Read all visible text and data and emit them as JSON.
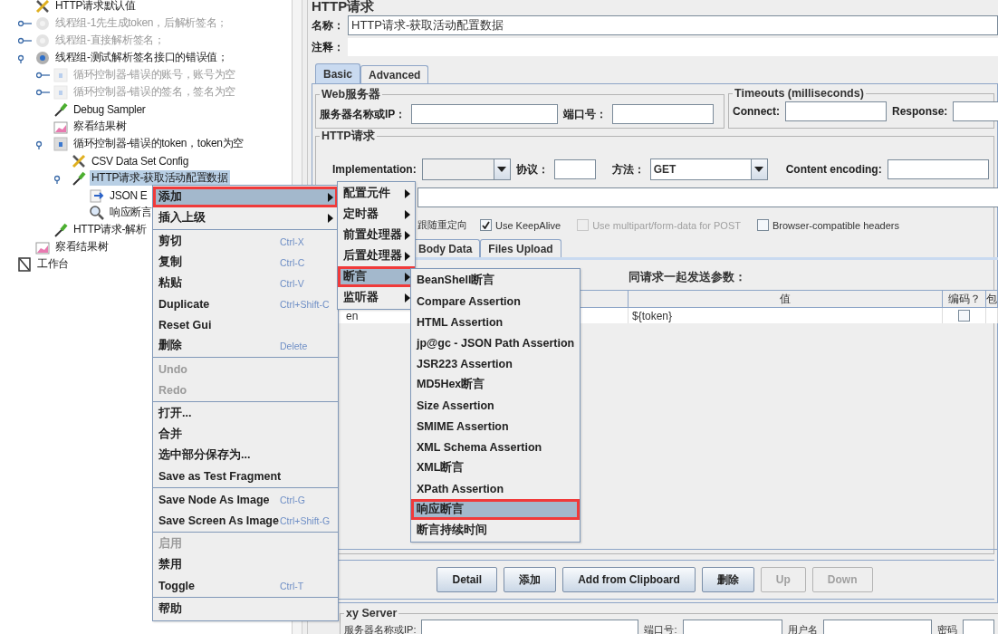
{
  "tree": {
    "plan_children": [
      {
        "label": "HTTP请求默认值",
        "kind": "config",
        "disabled": false,
        "selected": false
      },
      {
        "label": "线程组-1先生成token，后解析签名；",
        "kind": "thread-group",
        "disabled": true,
        "selected": false,
        "expanded": false
      },
      {
        "label": "线程组-直接解析签名；",
        "kind": "thread-group",
        "disabled": true,
        "selected": false,
        "expanded": false
      },
      {
        "label": "线程组-测试解析签名接口的错误值；",
        "kind": "thread-group",
        "disabled": false,
        "selected": false,
        "expanded": true,
        "children": [
          {
            "label": "循环控制器-错误的账号，账号为空",
            "kind": "controller",
            "disabled": true,
            "selected": false,
            "expanded": false
          },
          {
            "label": "循环控制器-错误的签名，签名为空",
            "kind": "controller",
            "disabled": true,
            "selected": false,
            "expanded": false
          },
          {
            "label": "Debug Sampler",
            "kind": "sampler",
            "disabled": false,
            "selected": false
          },
          {
            "label": "察看结果树",
            "kind": "listener",
            "disabled": false,
            "selected": false
          },
          {
            "label": "循环控制器-错误的token，token为空",
            "kind": "controller",
            "disabled": false,
            "selected": false,
            "expanded": true,
            "children": [
              {
                "label": "CSV Data Set Config",
                "kind": "config",
                "disabled": false,
                "selected": false
              },
              {
                "label": "HTTP请求-获取活动配置数据",
                "kind": "sampler",
                "disabled": false,
                "selected": true,
                "expanded": true,
                "children": [
                  {
                    "label": "JSON E",
                    "kind": "extractor",
                    "disabled": false,
                    "selected": false
                  },
                  {
                    "label": "响应断言",
                    "kind": "assertion",
                    "disabled": false,
                    "selected": false
                  }
                ]
              }
            ]
          },
          {
            "label": "HTTP请求-解析",
            "kind": "sampler",
            "disabled": false,
            "selected": false
          }
        ]
      },
      {
        "label": "察看结果树",
        "kind": "listener",
        "disabled": false,
        "selected": false
      }
    ],
    "roots": [
      {
        "label": "工作台",
        "kind": "workbench",
        "disabled": false,
        "selected": false
      }
    ]
  },
  "panel": {
    "title": "HTTP请求",
    "name": {
      "label": "名称：",
      "value": "HTTP请求-获取活动配置数据"
    },
    "comment": {
      "label": "注释："
    },
    "tabs": [
      {
        "label": "Basic",
        "selected": true
      },
      {
        "label": "Advanced",
        "selected": false
      }
    ],
    "web_server": {
      "title": "Web服务器",
      "fields": [
        {
          "label": "服务器名称或IP："
        },
        {
          "label": "端口号："
        }
      ]
    },
    "timeouts": {
      "title": "Timeouts (milliseconds)",
      "fields": [
        {
          "label": "Connect:"
        },
        {
          "label": "Response:"
        }
      ]
    },
    "http_request": {
      "title": "HTTP请求",
      "implementation_label": "Implementation:",
      "protocol_label": "协议：",
      "method_label": "方法：",
      "method": "GET",
      "encoding_label": "Content encoding:",
      "options": [
        {
          "label": "跟随重定向",
          "kind": "text"
        },
        {
          "label": "Use KeepAlive",
          "kind": "checkbox",
          "checked": true,
          "disabled": false
        },
        {
          "label": "Use multipart/form-data for POST",
          "kind": "checkbox",
          "checked": false,
          "disabled": true
        },
        {
          "label": "Browser-compatible headers",
          "kind": "checkbox",
          "checked": false,
          "disabled": false
        }
      ],
      "body_tabs": [
        {
          "label": "Body Data",
          "selected": false
        },
        {
          "label": "Files Upload",
          "selected": false
        }
      ],
      "params": {
        "caption": "同请求一起发送参数：",
        "columns": [
          {
            "label": "值"
          },
          {
            "label": "编码？"
          },
          {
            "label": "包"
          }
        ],
        "rows": [
          {
            "name": "en",
            "value": "${token}",
            "encode": false
          }
        ]
      }
    },
    "buttons": [
      {
        "label": "Detail",
        "disabled": false
      },
      {
        "label": "添加",
        "disabled": false
      },
      {
        "label": "Add from Clipboard",
        "disabled": false
      },
      {
        "label": "删除",
        "disabled": false
      },
      {
        "label": "Up",
        "disabled": true
      },
      {
        "label": "Down",
        "disabled": true
      }
    ],
    "proxy": {
      "title": "xy Server",
      "fields": [
        {
          "label": "服务器名称或IP:"
        },
        {
          "label": "端口号:"
        },
        {
          "label": "用户名"
        },
        {
          "label": "密码"
        }
      ]
    }
  },
  "context_menu": {
    "groups": [
      [
        {
          "label": "添加",
          "has_submenu": true,
          "selected": true,
          "highlighted": true,
          "disabled": false
        },
        {
          "label": "插入上级",
          "has_submenu": true,
          "selected": false,
          "highlighted": false,
          "disabled": false
        }
      ],
      [
        {
          "label": "剪切",
          "shortcut": "Ctrl-X",
          "selected": false,
          "highlighted": false,
          "disabled": false
        },
        {
          "label": "复制",
          "shortcut": "Ctrl-C",
          "selected": false,
          "highlighted": false,
          "disabled": false
        },
        {
          "label": "粘贴",
          "shortcut": "Ctrl-V",
          "selected": false,
          "highlighted": false,
          "disabled": false
        },
        {
          "label": "Duplicate",
          "shortcut": "Ctrl+Shift-C",
          "selected": false,
          "highlighted": false,
          "disabled": false
        },
        {
          "label": "Reset Gui",
          "selected": false,
          "highlighted": false,
          "disabled": false
        },
        {
          "label": "删除",
          "shortcut": "Delete",
          "selected": false,
          "highlighted": false,
          "disabled": false
        }
      ],
      [
        {
          "label": "Undo",
          "selected": false,
          "highlighted": false,
          "disabled": true
        },
        {
          "label": "Redo",
          "selected": false,
          "highlighted": false,
          "disabled": true
        }
      ],
      [
        {
          "label": "打开...",
          "selected": false,
          "highlighted": false,
          "disabled": false
        },
        {
          "label": "合并",
          "selected": false,
          "highlighted": false,
          "disabled": false
        },
        {
          "label": "选中部分保存为...",
          "selected": false,
          "highlighted": false,
          "disabled": false
        },
        {
          "label": "Save as Test Fragment",
          "selected": false,
          "highlighted": false,
          "disabled": false
        }
      ],
      [
        {
          "label": "Save Node As Image",
          "shortcut": "Ctrl-G",
          "selected": false,
          "highlighted": false,
          "disabled": false
        },
        {
          "label": "Save Screen As Image",
          "shortcut": "Ctrl+Shift-G",
          "selected": false,
          "highlighted": false,
          "disabled": false
        }
      ],
      [
        {
          "label": "启用",
          "selected": false,
          "highlighted": false,
          "disabled": true
        },
        {
          "label": "禁用",
          "selected": false,
          "highlighted": false,
          "disabled": false
        },
        {
          "label": "Toggle",
          "shortcut": "Ctrl-T",
          "selected": false,
          "highlighted": false,
          "disabled": false
        }
      ],
      [
        {
          "label": "帮助",
          "selected": false,
          "highlighted": false,
          "disabled": false
        }
      ]
    ]
  },
  "add_submenu": {
    "items": [
      {
        "label": "配置元件",
        "has_submenu": true,
        "selected": false,
        "highlighted": false
      },
      {
        "label": "定时器",
        "has_submenu": true,
        "selected": false,
        "highlighted": false
      },
      {
        "label": "前置处理器",
        "has_submenu": true,
        "selected": false,
        "highlighted": false
      },
      {
        "label": "后置处理器",
        "has_submenu": true,
        "selected": false,
        "highlighted": false
      },
      {
        "label": "断言",
        "has_submenu": true,
        "selected": true,
        "highlighted": true
      },
      {
        "label": "监听器",
        "has_submenu": true,
        "selected": false,
        "highlighted": false
      }
    ]
  },
  "assertion_submenu": {
    "items": [
      {
        "label": "BeanShell断言",
        "selected": false,
        "highlighted": false
      },
      {
        "label": "Compare Assertion",
        "selected": false,
        "highlighted": false
      },
      {
        "label": "HTML Assertion",
        "selected": false,
        "highlighted": false
      },
      {
        "label": "jp@gc - JSON Path Assertion",
        "selected": false,
        "highlighted": false
      },
      {
        "label": "JSR223 Assertion",
        "selected": false,
        "highlighted": false
      },
      {
        "label": "MD5Hex断言",
        "selected": false,
        "highlighted": false
      },
      {
        "label": "Size Assertion",
        "selected": false,
        "highlighted": false
      },
      {
        "label": "SMIME Assertion",
        "selected": false,
        "highlighted": false
      },
      {
        "label": "XML Schema Assertion",
        "selected": false,
        "highlighted": false
      },
      {
        "label": "XML断言",
        "selected": false,
        "highlighted": false
      },
      {
        "label": "XPath Assertion",
        "selected": false,
        "highlighted": false
      },
      {
        "label": "响应断言",
        "selected": true,
        "highlighted": true
      },
      {
        "label": "断言持续时间",
        "selected": false,
        "highlighted": false
      }
    ]
  }
}
